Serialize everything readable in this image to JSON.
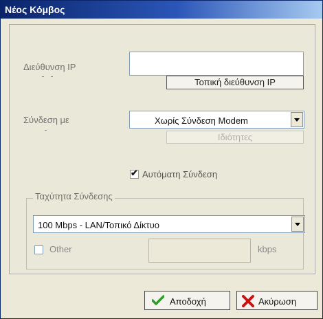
{
  "window": {
    "title": "Νέος Κόμβος"
  },
  "ip": {
    "label": "Διεύθυνση IP",
    "value": "",
    "local_button": "Τοπική διεύθυνση IP"
  },
  "connect": {
    "label": "Σύνδεση με",
    "selected": "Χωρίς Σύνδεση Modem",
    "properties_button": "Ιδιότητες"
  },
  "auto_connect": {
    "label": "Αυτόματη Σύνδεση",
    "checked": true
  },
  "speed": {
    "group_title": "Ταχύτητα Σύνδεσης",
    "selected": "100 Mbps - LAN/Τοπικό Δίκτυο",
    "other_label": "Other",
    "other_checked": false,
    "other_value": "",
    "unit": "kbps"
  },
  "actions": {
    "ok": "Αποδοχή",
    "cancel": "Ακύρωση"
  },
  "icons": {
    "ok": "checkmark-icon",
    "cancel": "red-x-icon",
    "dropdown": "chevron-down-icon"
  },
  "colors": {
    "title_bar": "#0a246a",
    "accept_green": "#2f9d2a",
    "cancel_red": "#cc1111"
  }
}
